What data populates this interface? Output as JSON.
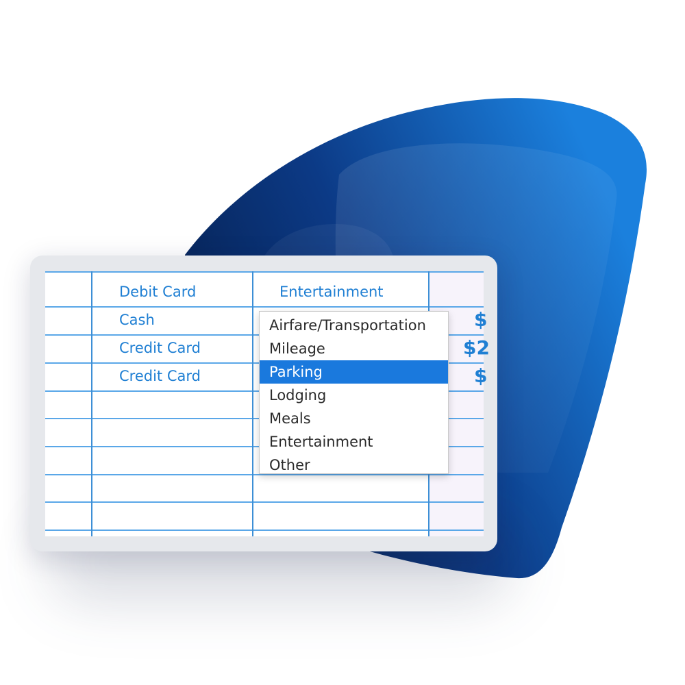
{
  "colors": {
    "shape_dark": "#06204f",
    "shape_light": "#1b7fdc",
    "grid_line": "#3d8fd6",
    "cell_text": "#1f7fd3",
    "selection": "#1a79dd"
  },
  "rows": [
    {
      "payment": "Debit Card",
      "category": "Entertainment",
      "amount": "$"
    },
    {
      "payment": "Cash",
      "category": "",
      "amount": "$"
    },
    {
      "payment": "Credit Card",
      "category": "",
      "amount": "$2"
    },
    {
      "payment": "Credit Card",
      "category": "",
      "amount": "$"
    }
  ],
  "category_dropdown": {
    "options": [
      "Airfare/Transportation",
      "Mileage",
      "Parking",
      "Lodging",
      "Meals",
      "Entertainment",
      "Other"
    ],
    "selected": "Parking"
  }
}
